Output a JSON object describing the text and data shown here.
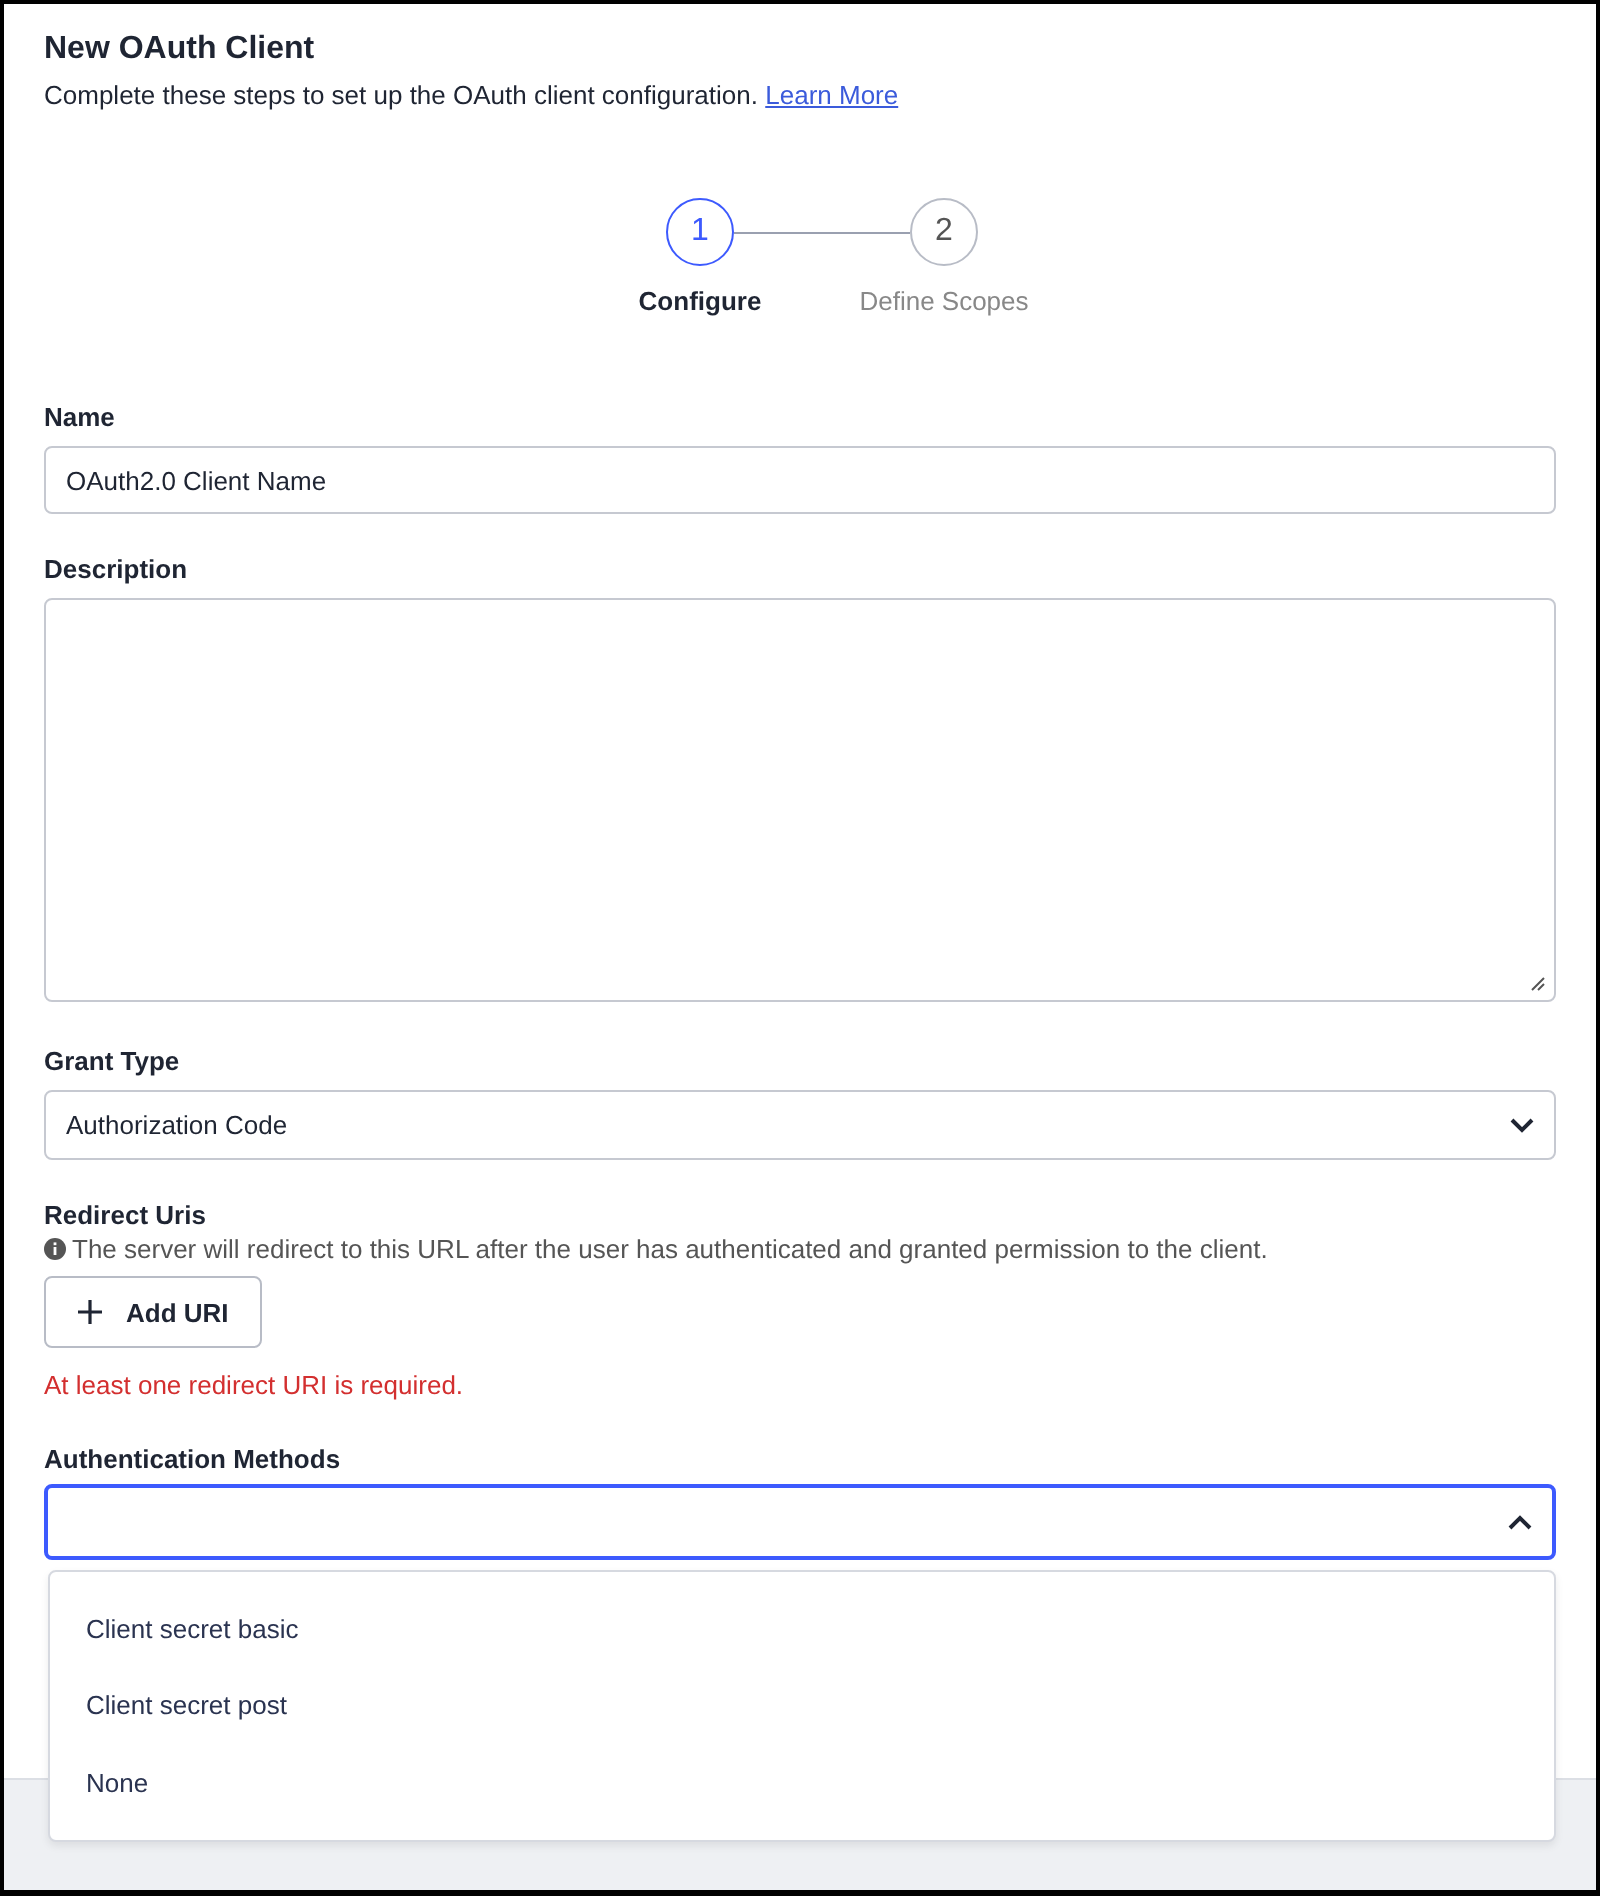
{
  "header": {
    "title": "New OAuth Client",
    "subtitle": "Complete these steps to set up the OAuth client configuration.",
    "link": "Learn More"
  },
  "steps": [
    {
      "number": "1",
      "label": "Configure",
      "active": true
    },
    {
      "number": "2",
      "label": "Define Scopes",
      "active": false
    }
  ],
  "name_field": {
    "label": "Name",
    "value": "OAuth2.0 Client Name"
  },
  "description_field": {
    "label": "Description"
  },
  "grant_type": {
    "label": "Grant Type",
    "value": "Authorization Code",
    "expanded": false
  },
  "redirect_uris": {
    "label": "Redirect Uris",
    "hint": "The server will redirect to this URL after the user has authenticated and granted permission to the client.",
    "button": "Add URI",
    "error": "At least one redirect URI is required."
  },
  "authentication_methods": {
    "label": "Authentication Methods",
    "expanded": true,
    "options": [
      "Client secret basic",
      "Client secret post",
      "None"
    ]
  }
}
